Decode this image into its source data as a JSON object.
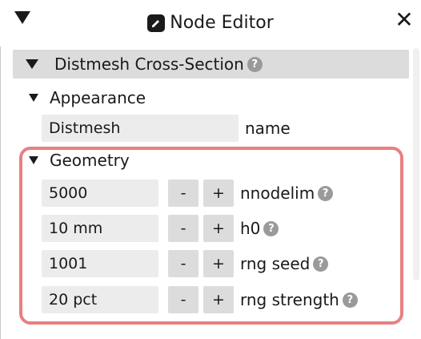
{
  "window": {
    "title": "Node Editor",
    "close_glyph": "✕"
  },
  "section": {
    "title": "Distmesh Cross-Section",
    "help_glyph": "?"
  },
  "appearance": {
    "label": "Appearance",
    "name_value": "Distmesh",
    "name_label": "name"
  },
  "geometry": {
    "label": "Geometry",
    "fields": [
      {
        "value": "5000",
        "label": "nnodelim"
      },
      {
        "value": "10 mm",
        "label": "h0"
      },
      {
        "value": "1001",
        "label": "rng seed"
      },
      {
        "value": "20 pct",
        "label": "rng strength"
      }
    ],
    "minus": "-",
    "plus": "+"
  },
  "colors": {
    "highlight": "#e88080",
    "header_bg": "#dcdcdc",
    "field_bg": "#ececec"
  }
}
